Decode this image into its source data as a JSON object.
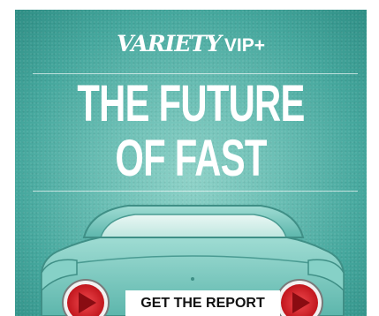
{
  "ad": {
    "brand": {
      "name": "VARIETY",
      "suffix": "VIP+"
    },
    "headline": {
      "line1": "THE FUTURE",
      "line2": "OF FAST"
    },
    "cta_label": "GET THE REPORT",
    "colors": {
      "background": "#5fb7ad",
      "car_body": "#7ccdc3",
      "taillight": "#d8232a",
      "text": "#ffffff"
    },
    "icons": [
      "car-illustration",
      "taillight-left-icon",
      "taillight-right-icon"
    ]
  }
}
